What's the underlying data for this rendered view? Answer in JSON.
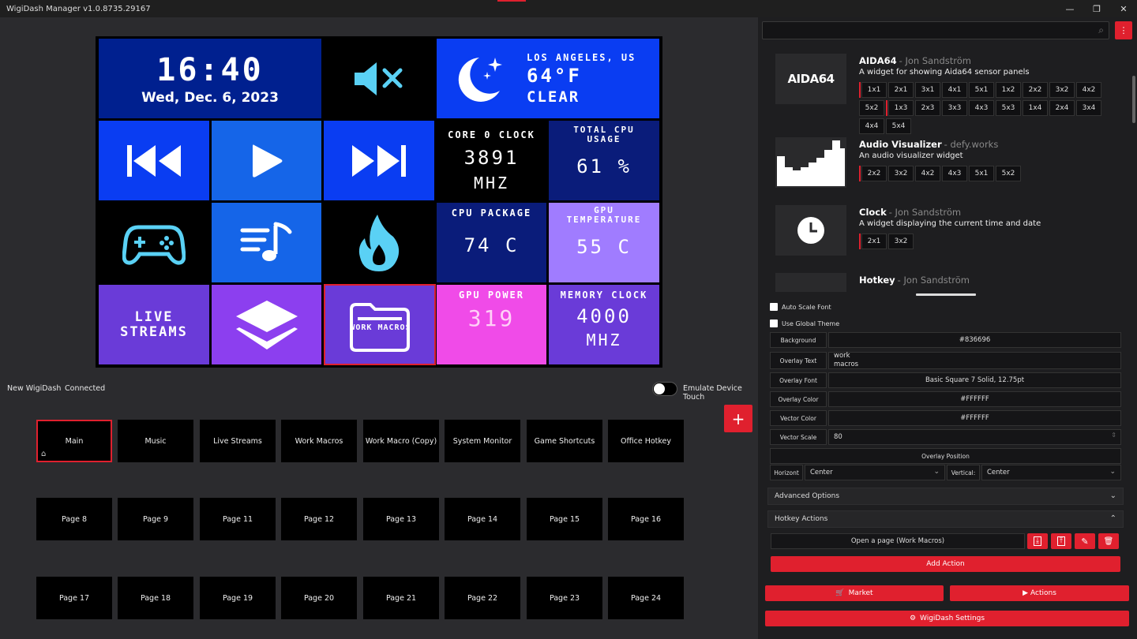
{
  "window": {
    "title": "WigiDash Manager v1.0.8735.29167",
    "min": "—",
    "max": "❐",
    "close": "✕"
  },
  "tiles": {
    "clock": {
      "time": "16:40",
      "date": "Wed, Dec. 6, 2023"
    },
    "weather": {
      "location": "LOS ANGELES, US",
      "temp": "64°F",
      "cond": "CLEAR"
    },
    "core_clock": {
      "label": "CORE 0 CLOCK",
      "value": "3891",
      "unit": "MHZ"
    },
    "cpu_usage": {
      "label": "TOTAL CPU USAGE",
      "value": "61 %"
    },
    "cpu_package": {
      "label": "CPU PACKAGE",
      "value": "74 C"
    },
    "gpu_temp": {
      "label": "GPU TEMPERATURE",
      "value": "55 C"
    },
    "live_streams": {
      "label": "LIVE STREAMS"
    },
    "work_macros": {
      "label": "WORK MACROS"
    },
    "gpu_power": {
      "label": "GPU POWER",
      "value": "319"
    },
    "memory_clock": {
      "label": "MEMORY CLOCK",
      "value": "4000",
      "unit": "MHZ"
    }
  },
  "device": {
    "name": "New WigiDash",
    "status": "Connected",
    "touch_label": "Emulate Device Touch"
  },
  "pages_row1": [
    "Main",
    "Music",
    "Live Streams",
    "Work Macros",
    "Work Macro (Copy)",
    "System Monitor",
    "Game Shortcuts",
    "Office Hotkey"
  ],
  "pages_row2": [
    "Page 8",
    "Page 9",
    "Page 11",
    "Page 12",
    "Page 13",
    "Page 14",
    "Page 15",
    "Page 16"
  ],
  "pages_row3": [
    "Page 17",
    "Page 18",
    "Page 19",
    "Page 20",
    "Page 21",
    "Page 22",
    "Page 23",
    "Page 24"
  ],
  "widgets": [
    {
      "name": "AIDA64",
      "author": "- Jon Sandström",
      "desc": "A widget for showing Aida64 sensor panels",
      "thumb": "AIDA64",
      "sizes": [
        "1x1",
        "2x1",
        "3x1",
        "4x1",
        "5x1",
        "1x2",
        "2x2",
        "3x2",
        "4x2",
        "5x2",
        "1x3",
        "2x3",
        "3x3",
        "4x3",
        "5x3",
        "1x4",
        "2x4",
        "3x4",
        "4x4",
        "5x4"
      ]
    },
    {
      "name": "Audio Visualizer",
      "author": "- defy.works",
      "desc": "An audio visualizer widget",
      "sizes": [
        "2x2",
        "3x2",
        "4x2",
        "4x3",
        "5x1",
        "5x2"
      ]
    },
    {
      "name": "Clock",
      "author": "- Jon Sandström",
      "desc": "A widget displaying the current time and date",
      "sizes": [
        "2x1",
        "3x2"
      ]
    },
    {
      "name": "Hotkey",
      "author": "- Jon Sandström",
      "desc": ""
    }
  ],
  "props": {
    "auto_scale": "Auto Scale Font",
    "global_theme": "Use Global Theme",
    "background_label": "Background",
    "background_value": "#836696",
    "overlay_text_label": "Overlay Text",
    "overlay_text_line1": "work",
    "overlay_text_line2": "macros",
    "overlay_font_label": "Overlay Font",
    "overlay_font_value": "Basic Square 7 Solid, 12.75pt",
    "overlay_color_label": "Overlay Color",
    "overlay_color_value": "#FFFFFF",
    "vector_color_label": "Vector Color",
    "vector_color_value": "#FFFFFF",
    "vector_scale_label": "Vector Scale",
    "vector_scale_value": "80",
    "overlay_position": "Overlay Position",
    "horizont_label": "Horizont",
    "horizont_value": "Center",
    "vertical_label": "Vertical:",
    "vertical_value": "Center",
    "advanced": "Advanced Options",
    "hotkey_actions": "Hotkey Actions",
    "action": "Open a page (Work Macros)",
    "add_action": "Add Action",
    "market": "Market",
    "actions": "Actions",
    "settings": "WigiDash Settings"
  },
  "colors": {
    "accent": "#e0202e",
    "tile_blue": "#0033ee",
    "tile_navy": "#001f8f",
    "tile_purple": "#6a3bd8",
    "tile_pink": "#f04be8",
    "tile_lilac": "#a07cff"
  }
}
